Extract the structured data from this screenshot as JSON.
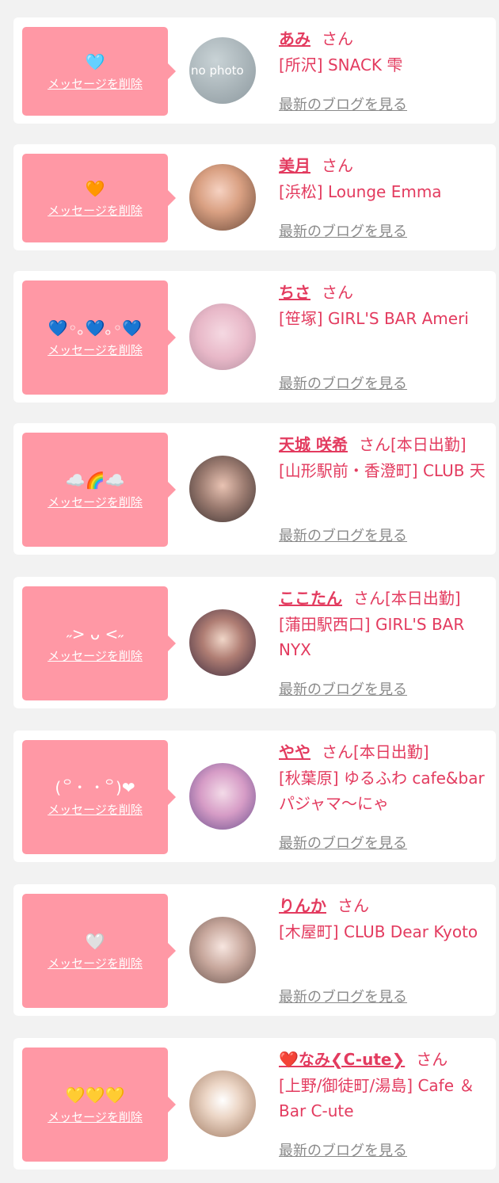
{
  "list": {
    "items": [
      {
        "message": "🩵",
        "delete_label": "メッセージを削除",
        "name": "あみ",
        "suffix": "さん",
        "shop": "[所沢] SNACK 雫",
        "blog_label": "最新のブログを見る",
        "avatar": "no-photo",
        "avatar_text": "no photo"
      },
      {
        "message": "🧡",
        "delete_label": "メッセージを削除",
        "name": "美月",
        "suffix": "さん",
        "shop": "[浜松] Lounge Emma",
        "blog_label": "最新のブログを見る",
        "avatar": "photo"
      },
      {
        "message": "💙◦｡💙｡◦💙",
        "delete_label": "メッセージを削除",
        "name": "ちさ",
        "suffix": "さん",
        "shop": "[笹塚] GIRL'S BAR Ameri",
        "blog_label": "最新のブログを見る",
        "avatar": "photo"
      },
      {
        "message": "☁️🌈☁️",
        "delete_label": "メッセージを削除",
        "name": "天城 咲希",
        "suffix": "さん[本日出勤]",
        "shop": "[山形駅前・香澄町] CLUB 天",
        "blog_label": "最新のブログを見る",
        "avatar": "photo"
      },
      {
        "message": "˶> ᴗ <˶",
        "delete_label": "メッセージを削除",
        "name": "ここたん",
        "suffix": "さん[本日出勤]",
        "shop": "[蒲田駅西口] GIRL'S BAR NYX",
        "blog_label": "最新のブログを見る",
        "avatar": "photo"
      },
      {
        "message": "(꒪・ ・꒪)❤︎",
        "delete_label": "メッセージを削除",
        "name": "やや",
        "suffix": "さん[本日出勤]",
        "shop": "[秋葉原] ゆるふわ cafe&bar パジャマ〜にゃ",
        "blog_label": "最新のブログを見る",
        "avatar": "photo"
      },
      {
        "message": "🤍",
        "delete_label": "メッセージを削除",
        "name": "りんか",
        "suffix": "さん",
        "shop": "[木屋町] CLUB Dear Kyoto",
        "blog_label": "最新のブログを見る",
        "avatar": "photo"
      },
      {
        "message": "💛💛💛",
        "delete_label": "メッセージを削除",
        "name": "❤️なみ❮C-ute❯",
        "suffix": "さん",
        "shop": "[上野/御徒町/湯島] Cafe ＆Bar C-ute",
        "blog_label": "最新のブログを見る",
        "avatar": "photo"
      }
    ]
  },
  "colors": {
    "accent": "#e33b5f",
    "bubble": "#ff98a5",
    "background": "#f2f2f2",
    "link_gray": "#8a8a8a"
  }
}
